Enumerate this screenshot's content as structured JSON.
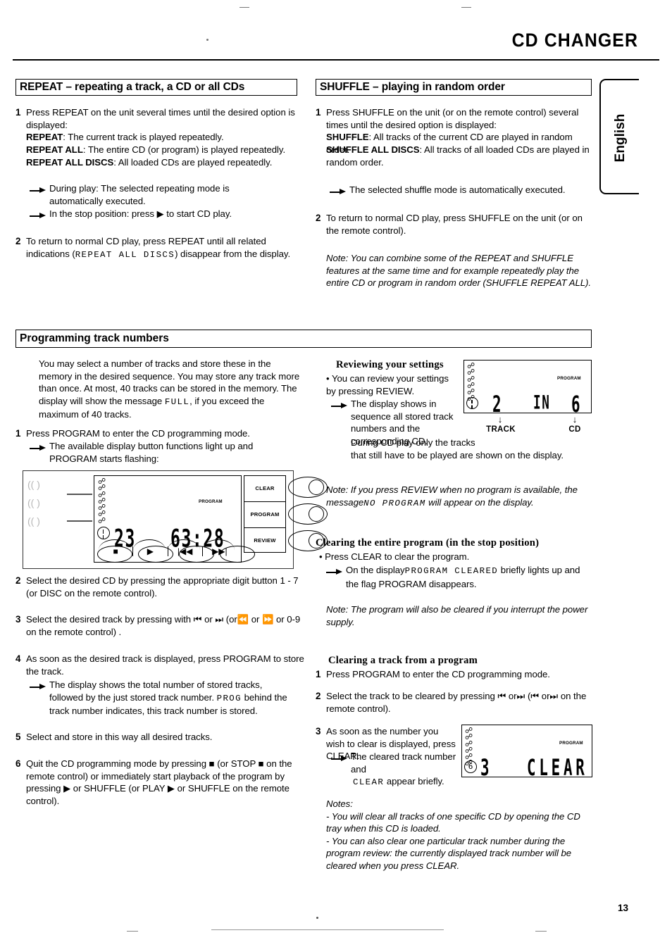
{
  "header": {
    "title": "CD CHANGER",
    "language_tab": "English",
    "page_number": "13"
  },
  "sections": {
    "repeat": {
      "heading": "REPEAT – repeating a track, a CD or all CDs",
      "step1_num": "1",
      "step1_intro": "Press REPEAT on the unit several times until the desired option is displayed:",
      "opt1_label": "REPEAT",
      "opt1_text": ": The current track is played repeatedly.",
      "opt2_label": "REPEAT ALL",
      "opt2_text": ": The entire CD (or program) is played repeatedly.",
      "opt3_label": "REPEAT ALL DISCS",
      "opt3_text": ": All loaded CDs are played repeatedly.",
      "bullet1": "During play: The selected repeating mode is automatically executed.",
      "bullet2_pre": "In the stop position: press",
      "bullet2_post": "to start CD play.",
      "step2_num": "2",
      "step2_pre": "To return to normal CD play, press REPEAT until all related indications (",
      "step2_lcd": "REPEAT ALL DISCS",
      "step2_post": ") disappear from the display."
    },
    "shuffle": {
      "heading": "SHUFFLE – playing in random order",
      "step1_num": "1",
      "step1_intro": "Press SHUFFLE on the unit (or on the remote control) several times until the desired option is displayed:",
      "opt1_label": "SHUFFLE",
      "opt1_text": ": All tracks of the current CD are played in random order.",
      "opt2_label": "SHUFFLE ALL DISCS",
      "opt2_text": ": All tracks of all loaded CDs are played in random order.",
      "bullet1": "The selected shuffle mode is automatically executed.",
      "step2_num": "2",
      "step2_text": "To return to normal CD play, press SHUFFLE on the unit (or on the remote control).",
      "note": "Note: You can combine some of the REPEAT and SHUFFLE features at the same time and for example repeatedly play the entire CD or program in random order (SHUFFLE REPEAT ALL)."
    },
    "programming": {
      "heading": "Programming track numbers",
      "intro_pre": "You may select a number of tracks and store these in the memory in the desired sequence. You may store any track more than once. At most, 40 tracks can be stored in the memory. The display will show the message",
      "intro_lcd": "FULL",
      "intro_post": ", if you exceed the maximum of 40 tracks.",
      "step1_num": "1",
      "step1_text": "Press PROGRAM to enter the CD programming mode.",
      "step1_bullet": "The available display button functions light up and PROGRAM starts flashing:",
      "step2_num": "2",
      "step2_text": "Select the desired CD by pressing the appropriate digit button 1 - 7 (or DISC on the remote control).",
      "step3_num": "3",
      "step3_a": "Select the desired track by pressing with",
      "step3_b": "or",
      "step3_c": "(or",
      "step3_d": "or",
      "step3_e": "or 0-9 on the remote control) .",
      "step4_num": "4",
      "step4_text": "As soon as the desired track is displayed, press PROGRAM to store the track.",
      "step4_bullet_pre": "The display shows the total number of stored tracks, followed by the just stored track number.",
      "step4_bullet_lcd": "PROG",
      "step4_bullet_post": "behind the track number indicates, this track number is stored.",
      "step5_num": "5",
      "step5_text": "Select and store in this way all desired tracks.",
      "step6_num": "6",
      "step6_a": "Quit the CD programming mode by pressing",
      "step6_b": "(or STOP",
      "step6_c": "on the remote control) or",
      "step6_d": "immediately start playback of the program by pressing",
      "step6_e": "or SHUFFLE (or PLAY",
      "step6_f": "or SHUFFLE on the remote control)."
    },
    "reviewing": {
      "heading": "Reviewing your settings",
      "bullet": "• You can review your settings by pressing REVIEW.",
      "arrow_text": "The display shows in sequence all stored track numbers and the corresponding CD.",
      "extra1": "During CD play only the tracks",
      "extra2": "that still have to be played are shown on the display.",
      "note_pre": "Note: If you press REVIEW when no program is available, the message",
      "note_lcd": "NO PROGRAM",
      "note_post": "will appear on the display."
    },
    "clearing_entire": {
      "heading": "Clearing the entire program (in the stop position)",
      "bullet": "• Press CLEAR to clear the program.",
      "arrow_pre": "On the display",
      "arrow_lcd": "PROGRAM CLEARED",
      "arrow_post": "briefly lights up and the flag PROGRAM disappears.",
      "note": "Note: The program will also be cleared if you interrupt the power supply."
    },
    "clearing_track": {
      "heading": "Clearing a track from a program",
      "step1_num": "1",
      "step1_text": "Press PROGRAM to enter the CD programming mode.",
      "step2_num": "2",
      "step2_a": "Select the track to be cleared by pressing",
      "step2_b": "or",
      "step2_c": "(",
      "step2_d": "or",
      "step2_e": "on the remote control).",
      "step3_num": "3",
      "step3_text": "As soon as the number you wish to clear is displayed, press CLEAR.",
      "step3_bullet_pre": "The cleared track number and",
      "step3_bullet_lcd": "CLEAR",
      "step3_bullet_post": "appear briefly.",
      "notes_title": "Notes:",
      "note1": "- You will clear all tracks of one specific CD by opening the CD tray when this CD is loaded.",
      "note2": "- You can also clear one particular track number during the program review: the currently displayed track number will be cleared when you press CLEAR."
    }
  },
  "figures": {
    "panel": {
      "lcd_track": "23",
      "lcd_time": "63:28",
      "lcd_program_flag": "PROGRAM",
      "softkey_stop": "■",
      "softkey_play": "▶",
      "softkey_prev": "|◀◀",
      "softkey_next": "▶▶|",
      "button_clear": "CLEAR",
      "button_program": "PROGRAM",
      "button_review": "REVIEW",
      "disc_marks": [
        "((   )",
        "((   )",
        "((   )"
      ]
    },
    "review_display": {
      "track_value": "2",
      "in_word": "IN",
      "cd_value": "6",
      "program_flag": "PROGRAM",
      "track_label": "TRACK",
      "cd_label": "CD",
      "arrow_glyph": "↓"
    },
    "clear_display": {
      "disc_number": "6",
      "track_value": "3",
      "message": "CLEAR",
      "program_flag": "PROGRAM"
    }
  }
}
